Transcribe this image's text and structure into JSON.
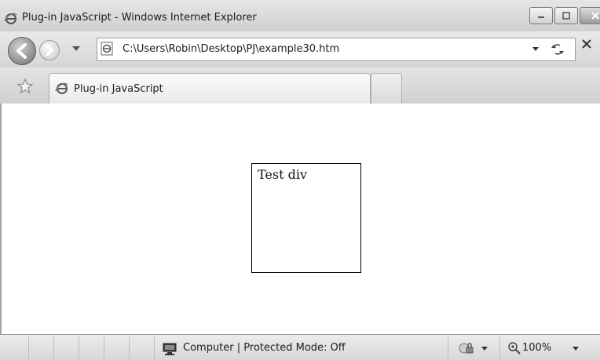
{
  "window": {
    "title": "Plug-in JavaScript - Windows Internet Explorer"
  },
  "address_bar": {
    "url": "C:\\Users\\Robin\\Desktop\\PJ\\example30.htm"
  },
  "tabs": [
    {
      "label": "Plug-in JavaScript",
      "active": true
    }
  ],
  "page": {
    "test_div_text": "Test div"
  },
  "status_bar": {
    "zone_text": "Computer | Protected Mode: Off",
    "zoom_level": "100%"
  },
  "icons": {
    "ie": "ie-icon",
    "back": "back-arrow-icon",
    "forward": "forward-arrow-icon",
    "refresh": "refresh-icon",
    "stop": "stop-icon",
    "favorites": "star-icon",
    "computer": "computer-icon",
    "security": "security-icon",
    "zoom": "zoom-icon"
  },
  "colors": {
    "chrome": "#d6d6d6",
    "content_bg": "#ffffff",
    "div_border": "#000000"
  }
}
